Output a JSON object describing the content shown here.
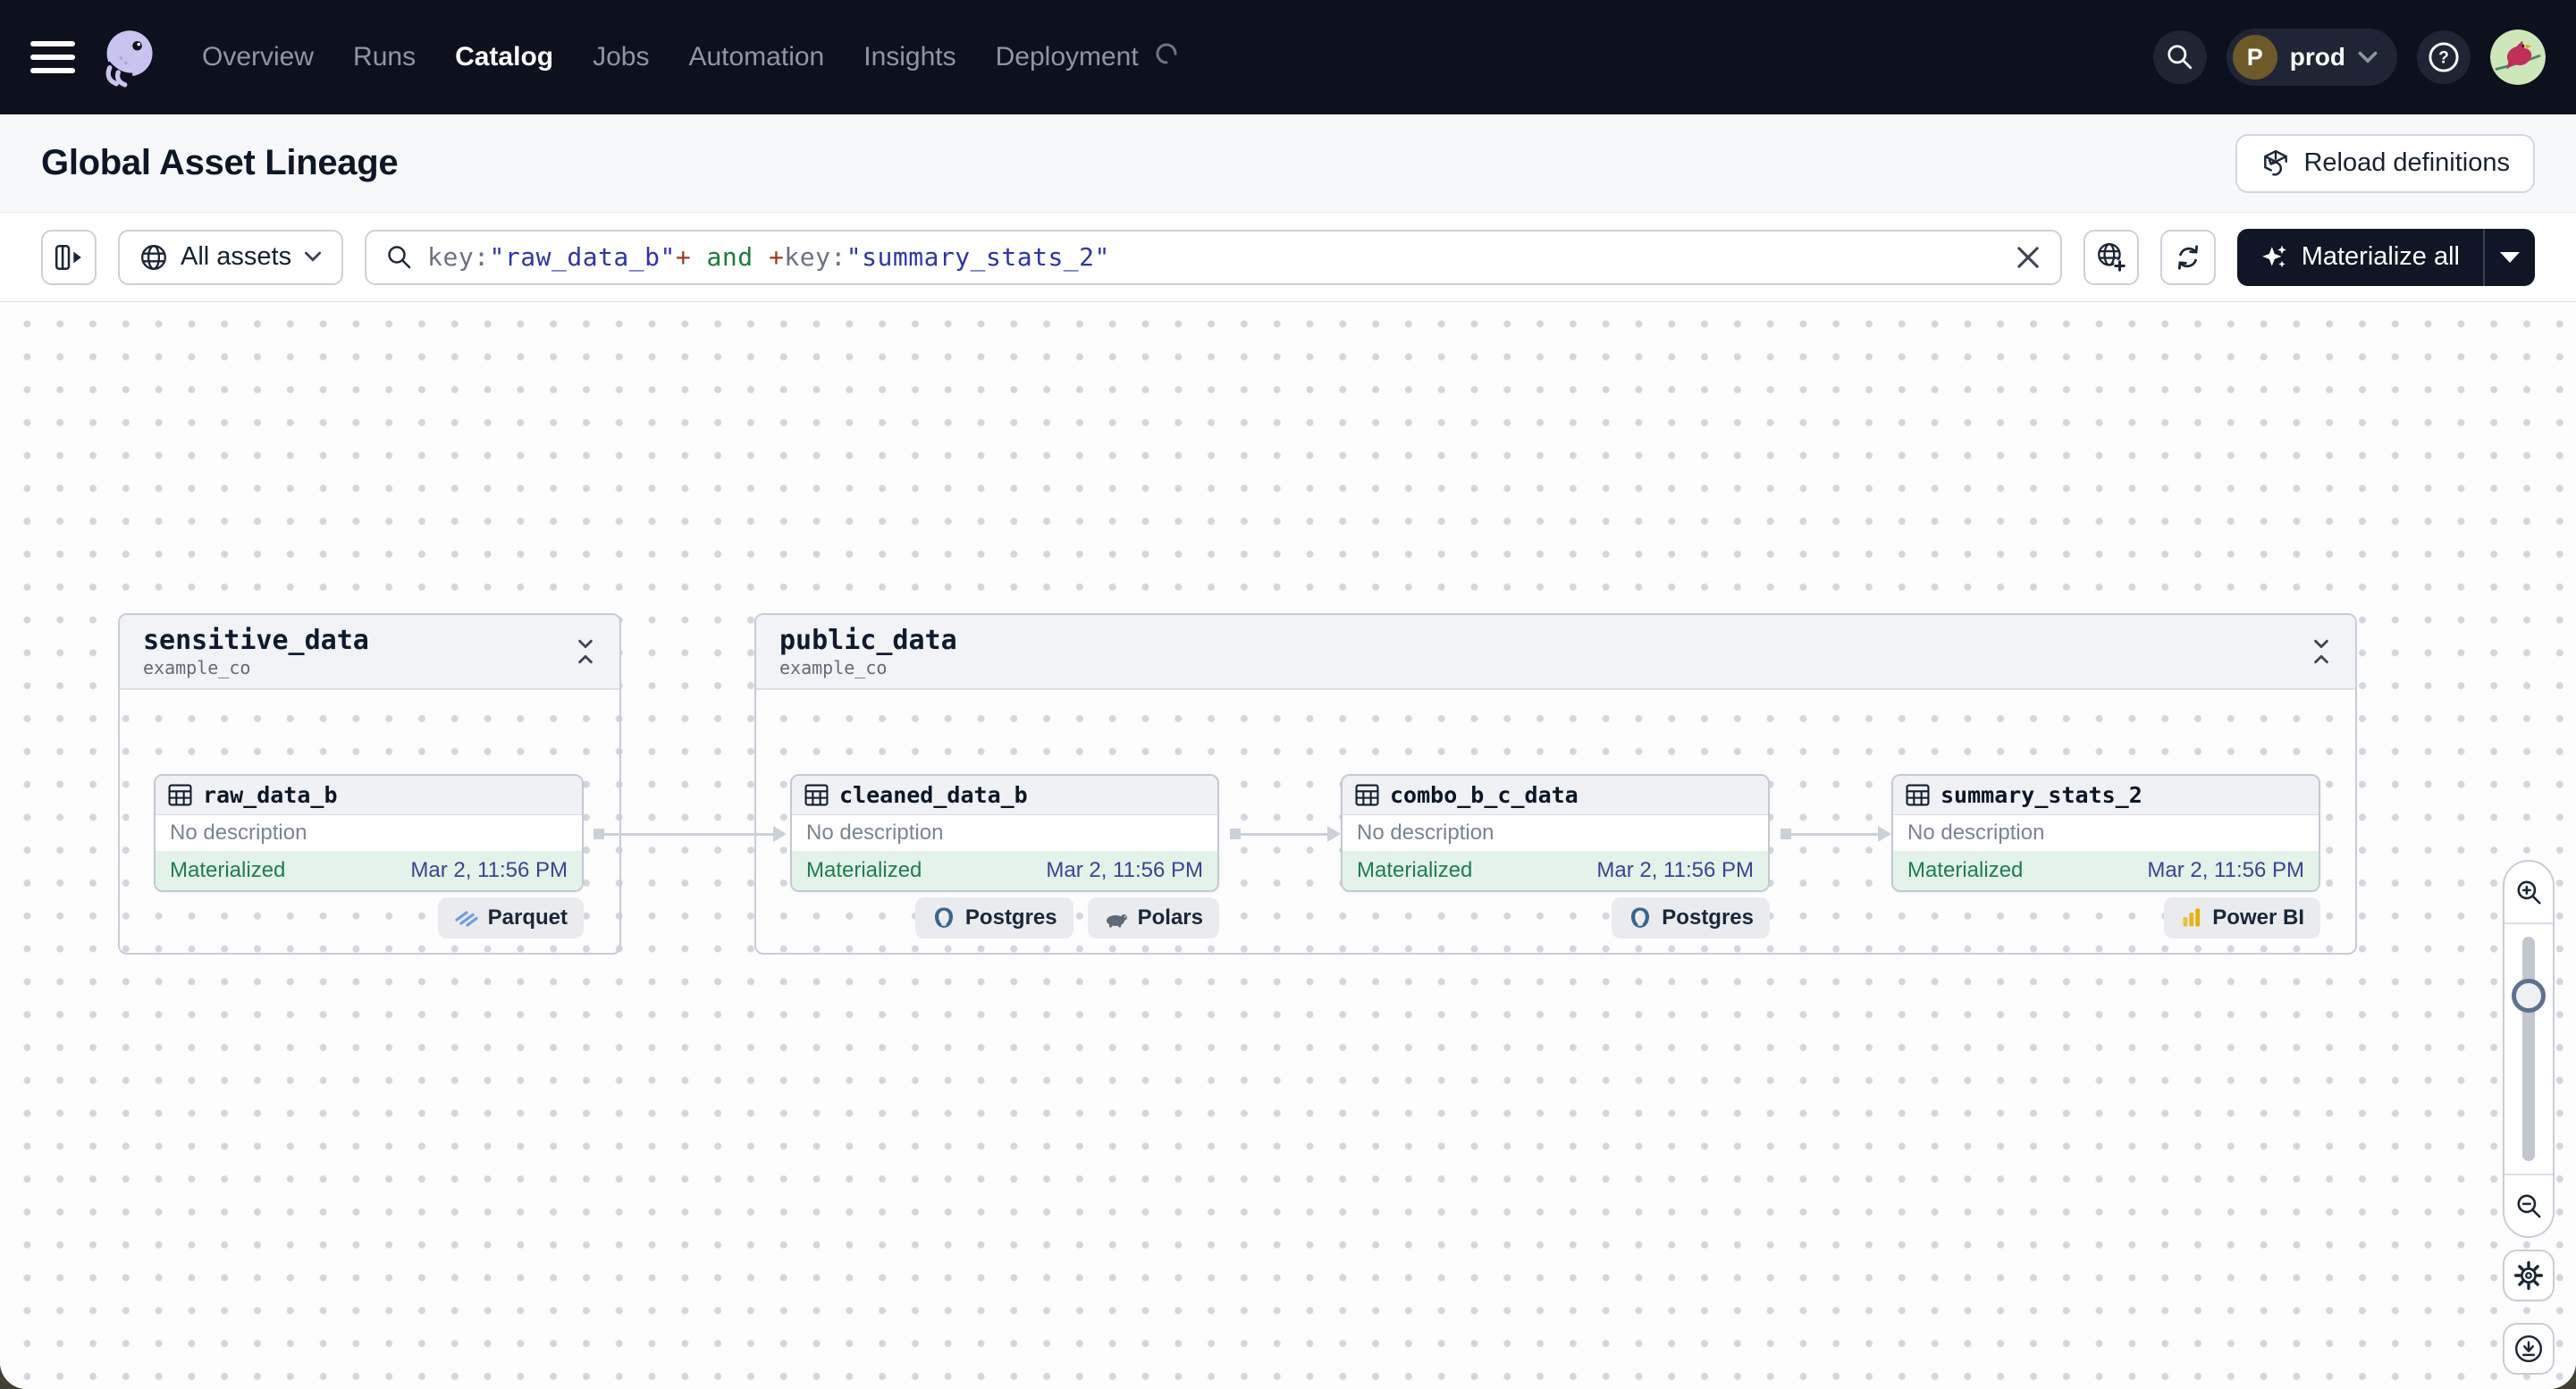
{
  "topbar": {
    "logo_icon": "dagster-octopus-logo",
    "nav_items": [
      {
        "label": "Overview",
        "active": false
      },
      {
        "label": "Runs",
        "active": false
      },
      {
        "label": "Catalog",
        "active": true
      },
      {
        "label": "Jobs",
        "active": false
      },
      {
        "label": "Automation",
        "active": false
      },
      {
        "label": "Insights",
        "active": false
      },
      {
        "label": "Deployment",
        "active": false
      }
    ],
    "environment": {
      "avatar_letter": "P",
      "label": "prod"
    }
  },
  "page_header": {
    "title": "Global Asset Lineage",
    "reload_button_label": "Reload definitions"
  },
  "toolbar": {
    "asset_scope_label": "All assets",
    "query_segments": [
      {
        "text": "key:",
        "type": "key"
      },
      {
        "text": "\"raw_data_b\"",
        "type": "string"
      },
      {
        "text": "+",
        "type": "operator"
      },
      {
        "text": " and ",
        "type": "keyword"
      },
      {
        "text": "+",
        "type": "operator"
      },
      {
        "text": "key:",
        "type": "key"
      },
      {
        "text": "\"summary_stats_2\"",
        "type": "string"
      }
    ],
    "materialize_button_label": "Materialize all"
  },
  "graph": {
    "groups": [
      {
        "name": "sensitive_data",
        "location": "example_co"
      },
      {
        "name": "public_data",
        "location": "example_co"
      }
    ],
    "assets": [
      {
        "name": "raw_data_b",
        "description": "No description",
        "status": "Materialized",
        "timestamp": "Mar 2, 11:56 PM",
        "tags": [
          {
            "label": "Parquet",
            "icon": "parquet-icon"
          }
        ]
      },
      {
        "name": "cleaned_data_b",
        "description": "No description",
        "status": "Materialized",
        "timestamp": "Mar 2, 11:56 PM",
        "tags": [
          {
            "label": "Postgres",
            "icon": "postgres-icon"
          },
          {
            "label": "Polars",
            "icon": "polars-icon"
          }
        ]
      },
      {
        "name": "combo_b_c_data",
        "description": "No description",
        "status": "Materialized",
        "timestamp": "Mar 2, 11:56 PM",
        "tags": [
          {
            "label": "Postgres",
            "icon": "postgres-icon"
          }
        ]
      },
      {
        "name": "summary_stats_2",
        "description": "No description",
        "status": "Materialized",
        "timestamp": "Mar 2, 11:56 PM",
        "tags": [
          {
            "label": "Power BI",
            "icon": "powerbi-icon"
          }
        ]
      }
    ]
  },
  "colors": {
    "topbar_bg": "#0d101d",
    "materialize_bg": "#101626",
    "status_green": "#1e7e4e",
    "status_strip_bg": "#e3f3e9",
    "timestamp_blue": "#3b4494",
    "syntax_key": "#6b7280",
    "syntax_string": "#2f35a7",
    "syntax_operator": "#9c3b24",
    "syntax_keyword": "#1e7a3c",
    "edge_gray": "#ccd0d7"
  }
}
